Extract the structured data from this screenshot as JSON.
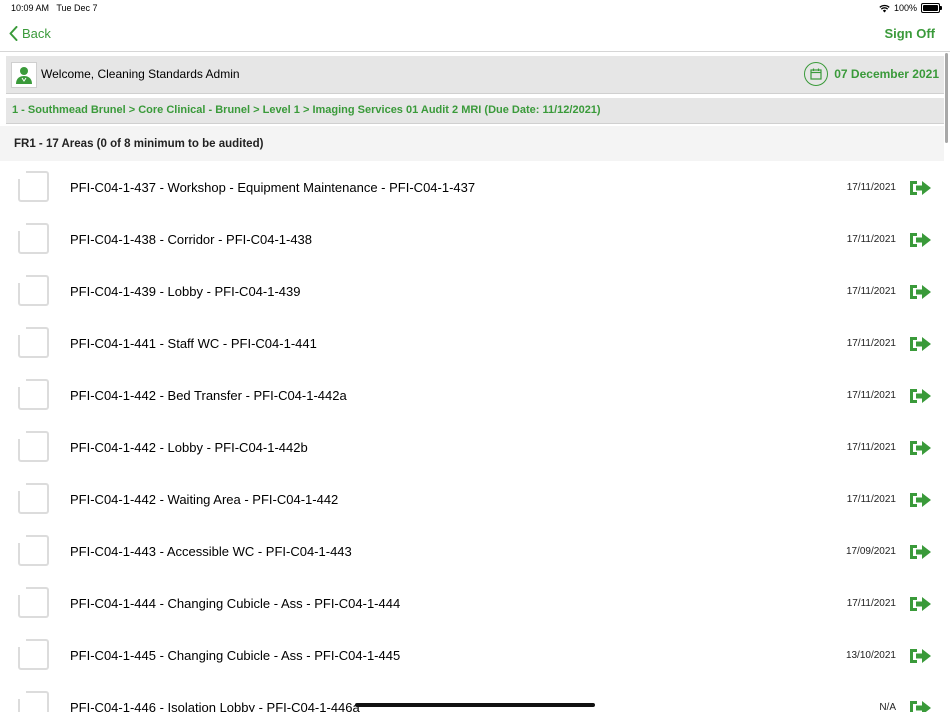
{
  "status_bar": {
    "time": "10:09 AM",
    "date": "Tue Dec 7",
    "battery": "100%"
  },
  "nav": {
    "back_label": "Back",
    "sign_off_label": "Sign Off"
  },
  "welcome": {
    "text": "Welcome, Cleaning Standards Admin",
    "date": "07 December 2021"
  },
  "breadcrumb": "1 - Southmead Brunel > Core Clinical - Brunel > Level 1 > Imaging Services 01 Audit 2 MRI (Due Date: 11/12/2021)",
  "section": {
    "title": "FR1 - 17 Areas (0 of 8 minimum to be audited)"
  },
  "areas": [
    {
      "title": "PFI-C04-1-437 - Workshop - Equipment Maintenance - PFI-C04-1-437",
      "date": "17/11/2021"
    },
    {
      "title": "PFI-C04-1-438 - Corridor - PFI-C04-1-438",
      "date": "17/11/2021"
    },
    {
      "title": "PFI-C04-1-439 - Lobby - PFI-C04-1-439",
      "date": "17/11/2021"
    },
    {
      "title": "PFI-C04-1-441 - Staff WC - PFI-C04-1-441",
      "date": "17/11/2021"
    },
    {
      "title": "PFI-C04-1-442 - Bed Transfer - PFI-C04-1-442a",
      "date": "17/11/2021"
    },
    {
      "title": "PFI-C04-1-442 - Lobby - PFI-C04-1-442b",
      "date": "17/11/2021"
    },
    {
      "title": "PFI-C04-1-442 - Waiting Area - PFI-C04-1-442",
      "date": "17/11/2021"
    },
    {
      "title": "PFI-C04-1-443 - Accessible WC - PFI-C04-1-443",
      "date": "17/09/2021"
    },
    {
      "title": "PFI-C04-1-444 - Changing Cubicle - Ass - PFI-C04-1-444",
      "date": "17/11/2021"
    },
    {
      "title": "PFI-C04-1-445 - Changing Cubicle - Ass - PFI-C04-1-445",
      "date": "13/10/2021"
    },
    {
      "title": "PFI-C04-1-446 - Isolation Lobby - PFI-C04-1-446a",
      "date": "N/A"
    }
  ],
  "colors": {
    "accent": "#3a9a3a",
    "header_bg": "#e6e6e6"
  },
  "icons": {
    "open_area": "sign-out-arrow-icon",
    "checkbox": "checkbox-icon",
    "calendar": "calendar-icon",
    "avatar": "user-avatar-icon"
  }
}
